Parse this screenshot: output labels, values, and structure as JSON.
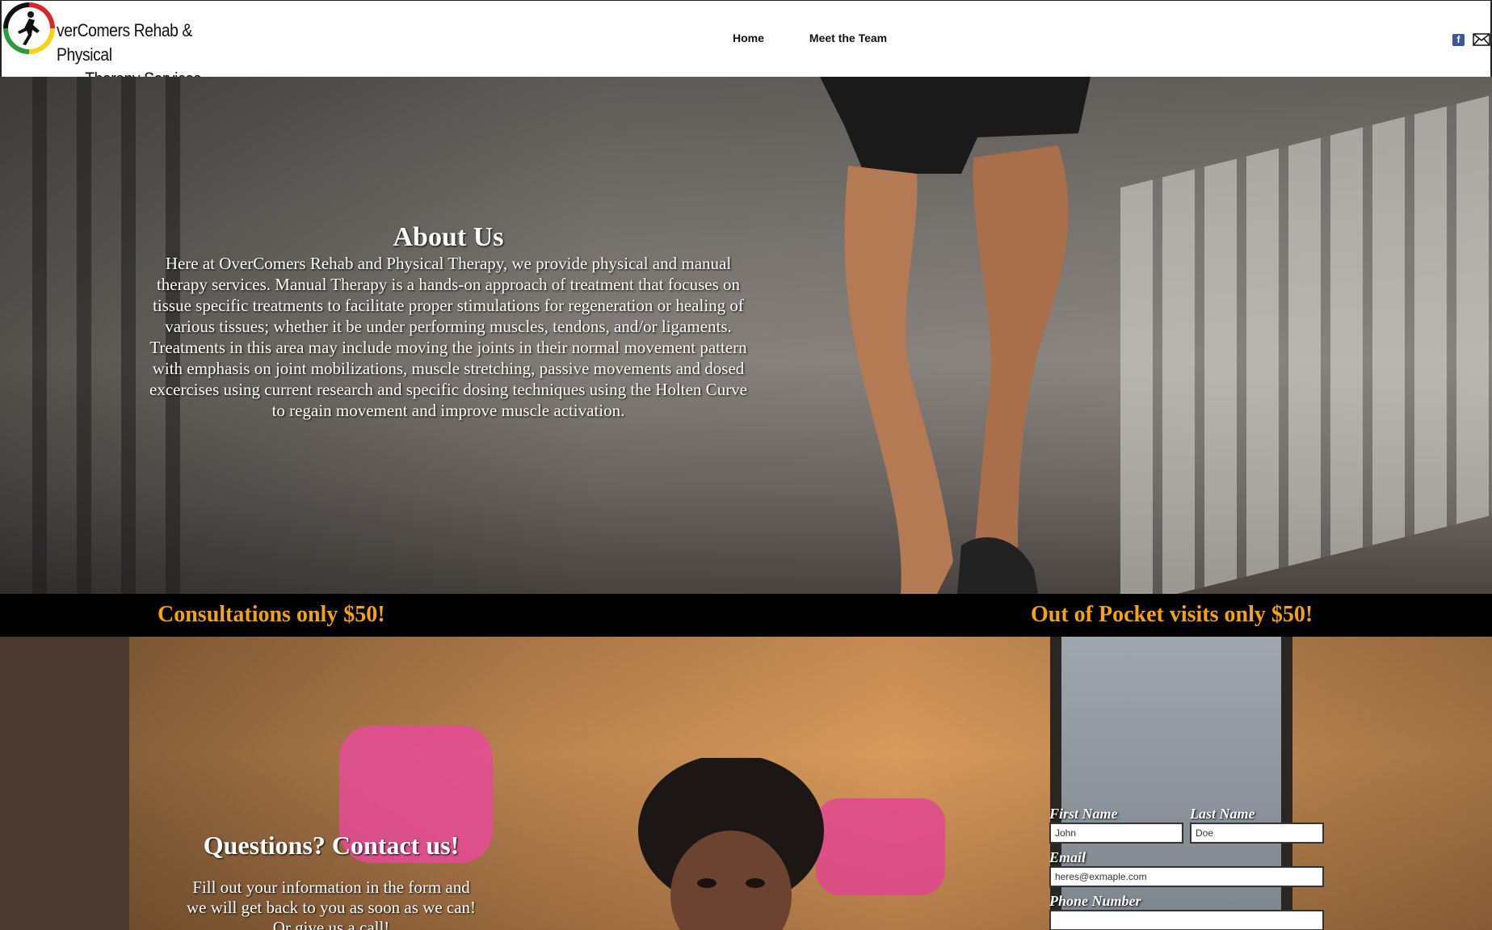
{
  "header": {
    "logo": {
      "line1": "verComers Rehab & Physical",
      "line2": "Therapy Services"
    },
    "nav": [
      "Home",
      "Meet the Team"
    ],
    "social": {
      "facebook_glyph": "f",
      "icons": [
        "facebook-icon",
        "mail-icon"
      ]
    }
  },
  "hero": {
    "title": "About Us",
    "body": "Here at OverComers Rehab and Physical Therapy, we provide physical and manual therapy services. Manual Therapy is a hands-on approach of treatment that focuses on tissue specific treatments to facilitate proper stimulations for regeneration or healing of various tissues; whether it be under performing muscles, tendons, and/or ligaments. Treatments in this area may include moving the joints in their normal movement pattern with emphasis on joint mobilizations, muscle stretching, passive movements and dosed excercises using current research and specific dosing techniques using the Holten Curve to regain movement and improve muscle activation."
  },
  "promo": {
    "left": "Consultations only $50!",
    "right": "Out of Pocket visits only $50!",
    "color": "#f5a20e"
  },
  "contact": {
    "title": "Questions? Contact us!",
    "body": "Fill out your information in the form and we will get back to you as soon as we can! Or give us a call!",
    "form": {
      "first_name_label": "First Name",
      "first_name_value": "John",
      "last_name_label": "Last Name",
      "last_name_value": "Doe",
      "email_label": "Email",
      "email_value": "heres@exmaple.com",
      "phone_label": "Phone Number"
    }
  }
}
